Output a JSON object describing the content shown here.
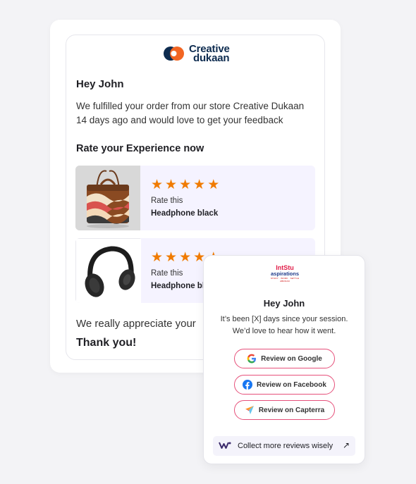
{
  "brand": {
    "logo_line1": "Creative",
    "logo_line2": "dukaan"
  },
  "email": {
    "greeting": "Hey John",
    "message": "We fulfilled your order from our store Creative Dukaan 14 days ago and would love to get your feedback",
    "rate_heading": "Rate your Experience now",
    "products": [
      {
        "stars": 5,
        "rate_label": "Rate this",
        "name": "Headphone black",
        "image": "laptop-bag"
      },
      {
        "stars": 5,
        "rate_label": "Rate this",
        "name": "Headphone black",
        "image": "headphones"
      }
    ],
    "appreciate": "We really appreciate your",
    "thank_you": "Thank you!"
  },
  "review_widget": {
    "logo_line1": "Int",
    "logo_line1b": "Stu",
    "logo_line2": "aspirations",
    "logo_tagline": "STUDY · WORK · SETTLE ABROAD",
    "greeting": "Hey John",
    "message": "It’s been [X] days since your session. We’d love to hear how it went.",
    "buttons": [
      {
        "label": "Review on Google",
        "icon": "google-icon"
      },
      {
        "label": "Review on Facebook",
        "icon": "facebook-icon"
      },
      {
        "label": "Review on Capterra",
        "icon": "capterra-icon"
      }
    ],
    "collect_label": "Collect more reviews wisely",
    "collect_arrow": "↗"
  },
  "colors": {
    "star": "#f07b00",
    "brand_navy": "#0d2b4f",
    "brand_orange": "#f26522",
    "button_border": "#e6507a",
    "product_bg": "#f5f3ff"
  }
}
